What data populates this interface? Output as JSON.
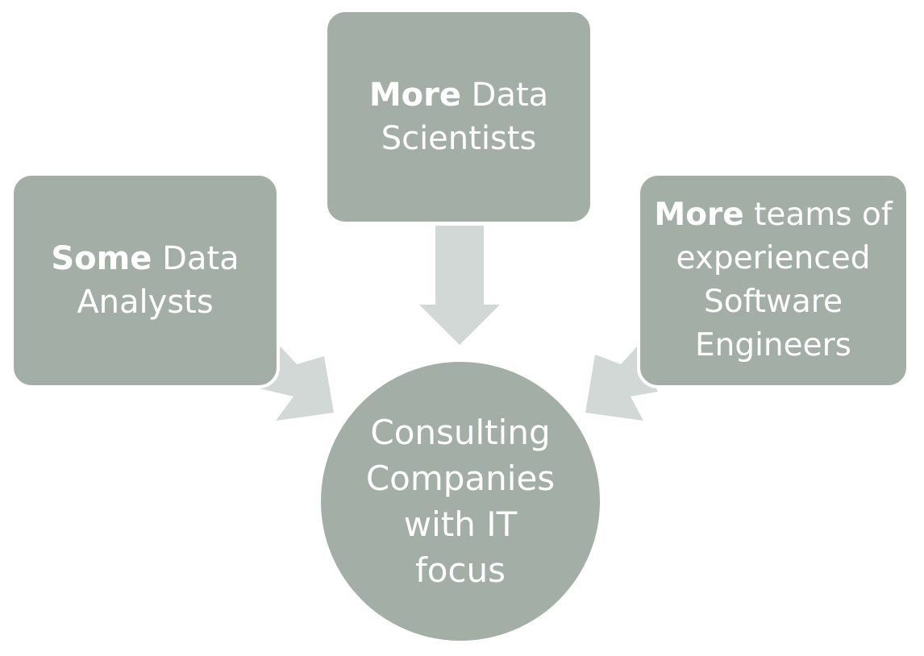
{
  "colors": {
    "node_fill": "#a3aea6",
    "arrow_fill": "#d2d8d5",
    "text": "#ffffff",
    "background": "#ffffff"
  },
  "nodes": {
    "top": {
      "bold": "More",
      "rest": "Data",
      "line2": "Scientists"
    },
    "left": {
      "bold": "Some",
      "rest": "Data",
      "line2": "Analysts"
    },
    "right": {
      "bold": "More",
      "rest": "teams of",
      "line2": "experienced",
      "line3": "Software",
      "line4": "Engineers"
    },
    "center": {
      "line1": "Consulting",
      "line2": "Companies",
      "line3": "with IT",
      "line4": "focus"
    }
  }
}
